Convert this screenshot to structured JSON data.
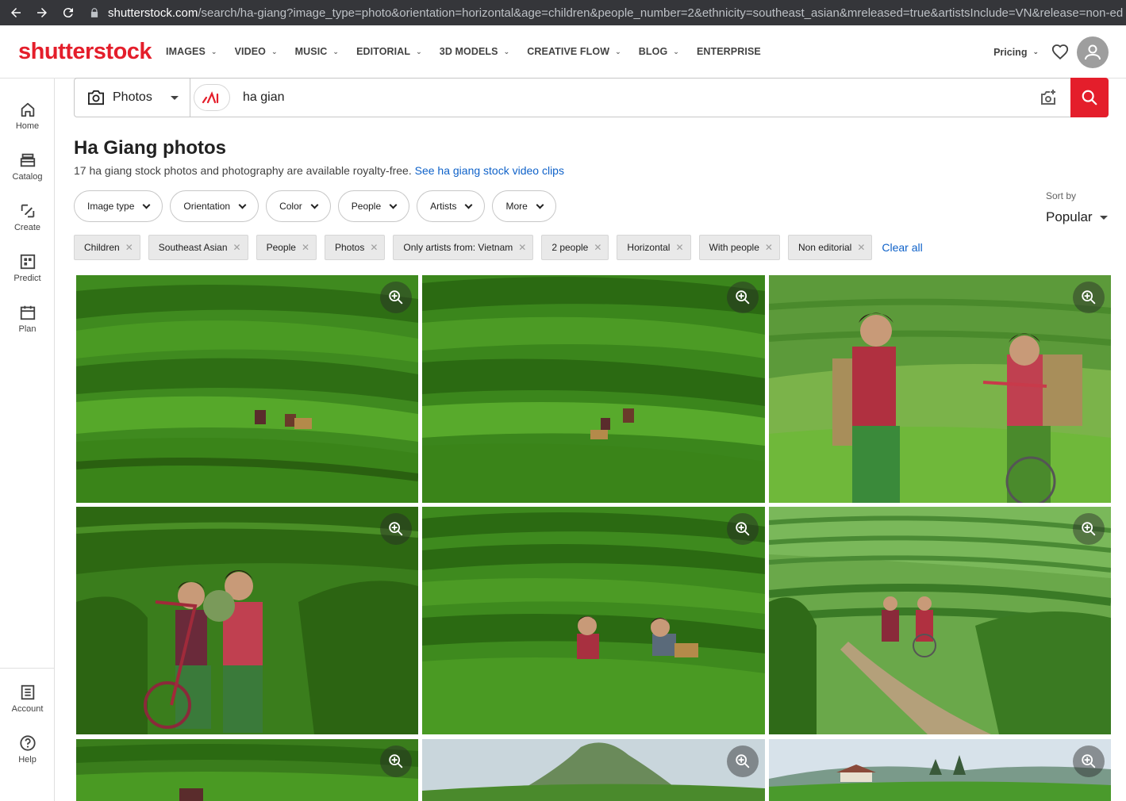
{
  "browser": {
    "url_host": "shutterstock.com",
    "url_rest": "/search/ha-giang?image_type=photo&orientation=horizontal&age=children&people_number=2&ethnicity=southeast_asian&mreleased=true&artistsInclude=VN&release=non-ed"
  },
  "header": {
    "logo_text": "shutterstock",
    "nav": [
      "IMAGES",
      "VIDEO",
      "MUSIC",
      "EDITORIAL",
      "3D MODELS",
      "CREATIVE FLOW",
      "BLOG",
      "ENTERPRISE"
    ],
    "pricing": "Pricing"
  },
  "rail": {
    "items": [
      "Home",
      "Catalog",
      "Create",
      "Predict",
      "Plan"
    ],
    "bottom_items": [
      "Account",
      "Help"
    ]
  },
  "search": {
    "type": "Photos",
    "query": "ha gian"
  },
  "page": {
    "title": "Ha Giang photos",
    "subtitle": "17 ha giang stock photos and photography are available royalty-free.",
    "video_link": "See ha giang stock video clips"
  },
  "filters": [
    "Image type",
    "Orientation",
    "Color",
    "People",
    "Artists",
    "More"
  ],
  "sort": {
    "label": "Sort by",
    "value": "Popular"
  },
  "chips": [
    "Children",
    "Southeast Asian",
    "People",
    "Photos",
    "Only artists from: Vietnam",
    "2 people",
    "Horizontal",
    "With people",
    "Non editorial"
  ],
  "clear_all": "Clear all",
  "colors": {
    "brand": "#e41e2b",
    "link": "#0f62c9",
    "tea_green": "#2e7d1e"
  }
}
